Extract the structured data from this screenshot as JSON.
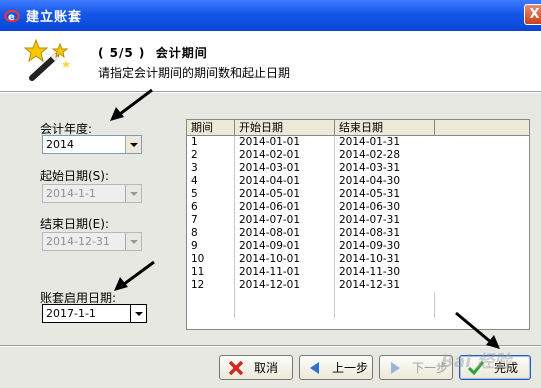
{
  "window": {
    "title": "建立账套",
    "close_glyph": "X"
  },
  "header": {
    "step": "( 5/5 )  会计期间",
    "description": "请指定会计期间的期间数和起止日期"
  },
  "form": {
    "fiscal_year_label": "会计年度:",
    "fiscal_year_value": "2014",
    "start_date_label": "起始日期(S):",
    "start_date_value": "2014-1-1",
    "end_date_label": "结束日期(E):",
    "end_date_value": "2014-12-31",
    "enable_date_label": "账套启用日期:",
    "enable_date_value": "2017-1-1"
  },
  "periods_table": {
    "columns": [
      "期间",
      "开始日期",
      "结束日期"
    ],
    "rows": [
      [
        "1",
        "2014-01-01",
        "2014-01-31"
      ],
      [
        "2",
        "2014-02-01",
        "2014-02-28"
      ],
      [
        "3",
        "2014-03-01",
        "2014-03-31"
      ],
      [
        "4",
        "2014-04-01",
        "2014-04-30"
      ],
      [
        "5",
        "2014-05-01",
        "2014-05-31"
      ],
      [
        "6",
        "2014-06-01",
        "2014-06-30"
      ],
      [
        "7",
        "2014-07-01",
        "2014-07-31"
      ],
      [
        "8",
        "2014-08-01",
        "2014-08-31"
      ],
      [
        "9",
        "2014-09-01",
        "2014-09-30"
      ],
      [
        "10",
        "2014-10-01",
        "2014-10-31"
      ],
      [
        "11",
        "2014-11-01",
        "2014-11-30"
      ],
      [
        "12",
        "2014-12-01",
        "2014-12-31"
      ]
    ]
  },
  "buttons": {
    "cancel": "取消",
    "prev": "上一步",
    "next": "下一步",
    "finish": "完成"
  },
  "watermark": "Bai 经验",
  "icons": {
    "app": "app-logo-icon",
    "wizard": "magic-wand-icon",
    "cancel": "x-icon",
    "prev": "left-arrow-icon",
    "next": "right-arrow-icon",
    "finish": "check-icon"
  },
  "colors": {
    "titlebar": "#0a46d6",
    "panel": "#e8e8e3",
    "cancel_icon": "#d42a1e",
    "nav_icon": "#2f6fd0",
    "finish_icon": "#2ea23a"
  }
}
